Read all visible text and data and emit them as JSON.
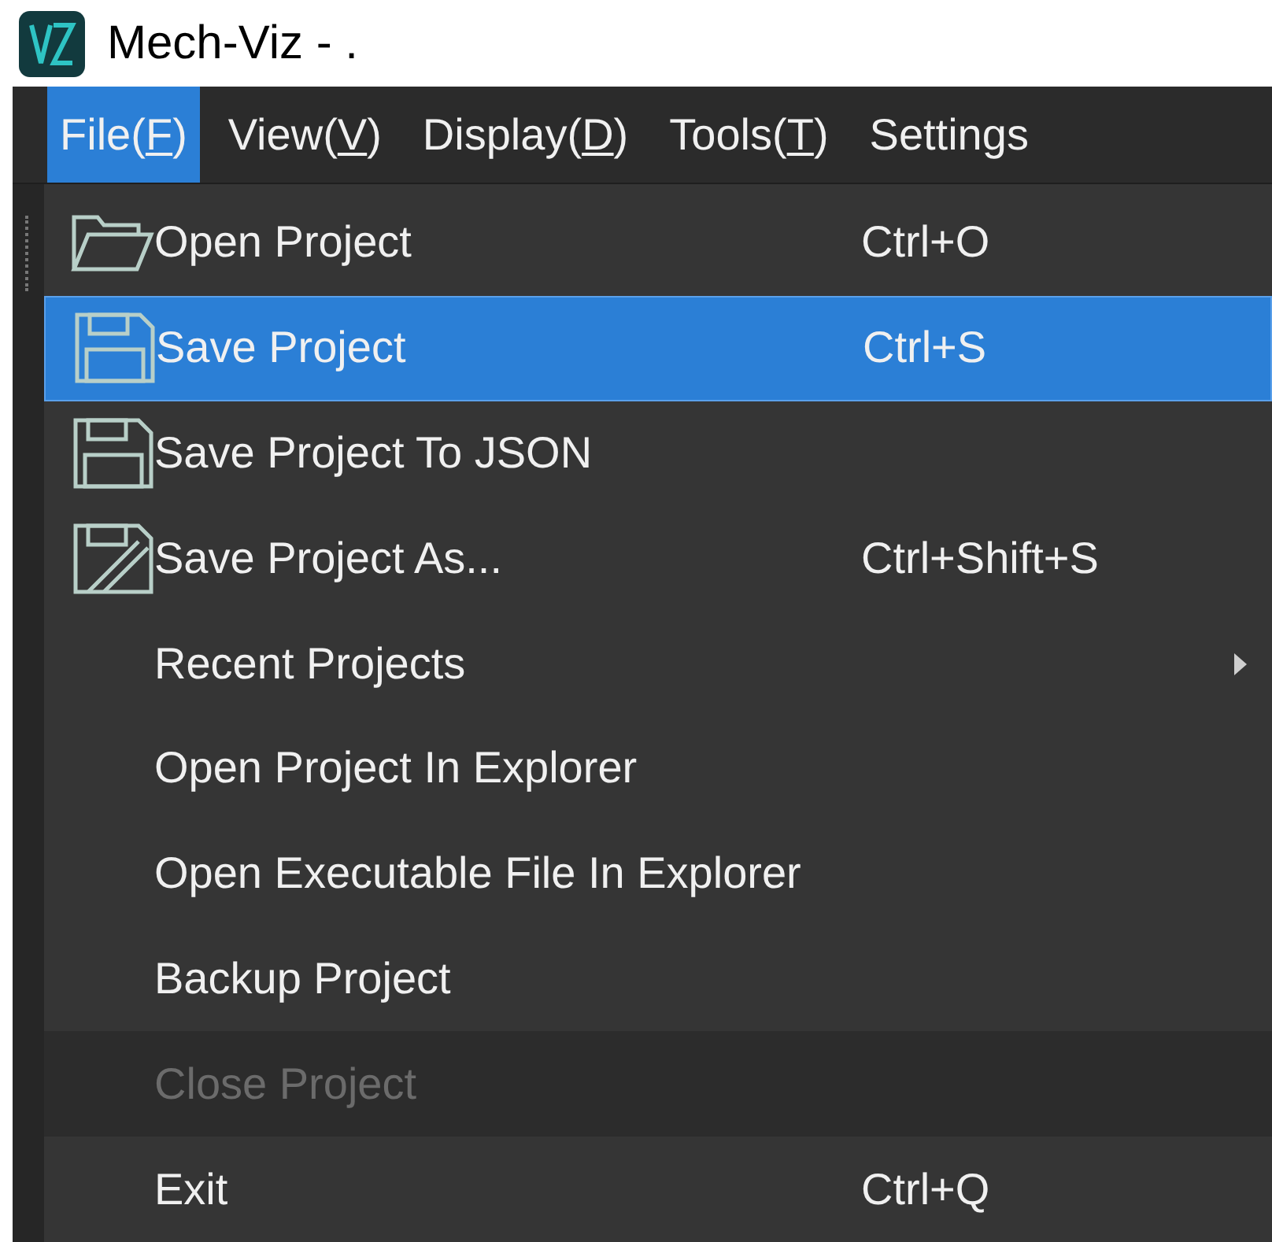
{
  "window": {
    "title": "Mech-Viz - ."
  },
  "menubar": [
    {
      "prefix": "File(",
      "mnemonic": "F",
      "suffix": ")",
      "selected": true
    },
    {
      "prefix": "View(",
      "mnemonic": "V",
      "suffix": ")",
      "selected": false
    },
    {
      "prefix": "Display(",
      "mnemonic": "D",
      "suffix": ")",
      "selected": false
    },
    {
      "prefix": "Tools(",
      "mnemonic": "T",
      "suffix": ")",
      "selected": false
    },
    {
      "prefix": "Settings",
      "selected": false
    }
  ],
  "menu": [
    {
      "label": "Open Project",
      "shortcut": "Ctrl+O",
      "selected": false,
      "disabled": false,
      "submenu": false
    },
    {
      "label": "Save Project",
      "shortcut": "Ctrl+S",
      "selected": true,
      "disabled": false,
      "submenu": false
    },
    {
      "label": "Save Project To JSON",
      "selected": false,
      "disabled": false,
      "submenu": false
    },
    {
      "label": "Save Project As...",
      "shortcut": "Ctrl+Shift+S",
      "selected": false,
      "disabled": false,
      "submenu": false
    },
    {
      "label": "Recent Projects",
      "selected": false,
      "disabled": false,
      "submenu": true
    },
    {
      "label": "Open Project In Explorer",
      "selected": false,
      "disabled": false,
      "submenu": false
    },
    {
      "label": "Open Executable File In Explorer",
      "selected": false,
      "disabled": false,
      "submenu": false
    },
    {
      "label": "Backup Project",
      "selected": false,
      "disabled": false,
      "submenu": false
    },
    {
      "label": "Close Project",
      "selected": false,
      "disabled": true,
      "submenu": false
    },
    {
      "label": "Exit",
      "shortcut": "Ctrl+Q",
      "selected": false,
      "disabled": false,
      "submenu": false
    }
  ]
}
